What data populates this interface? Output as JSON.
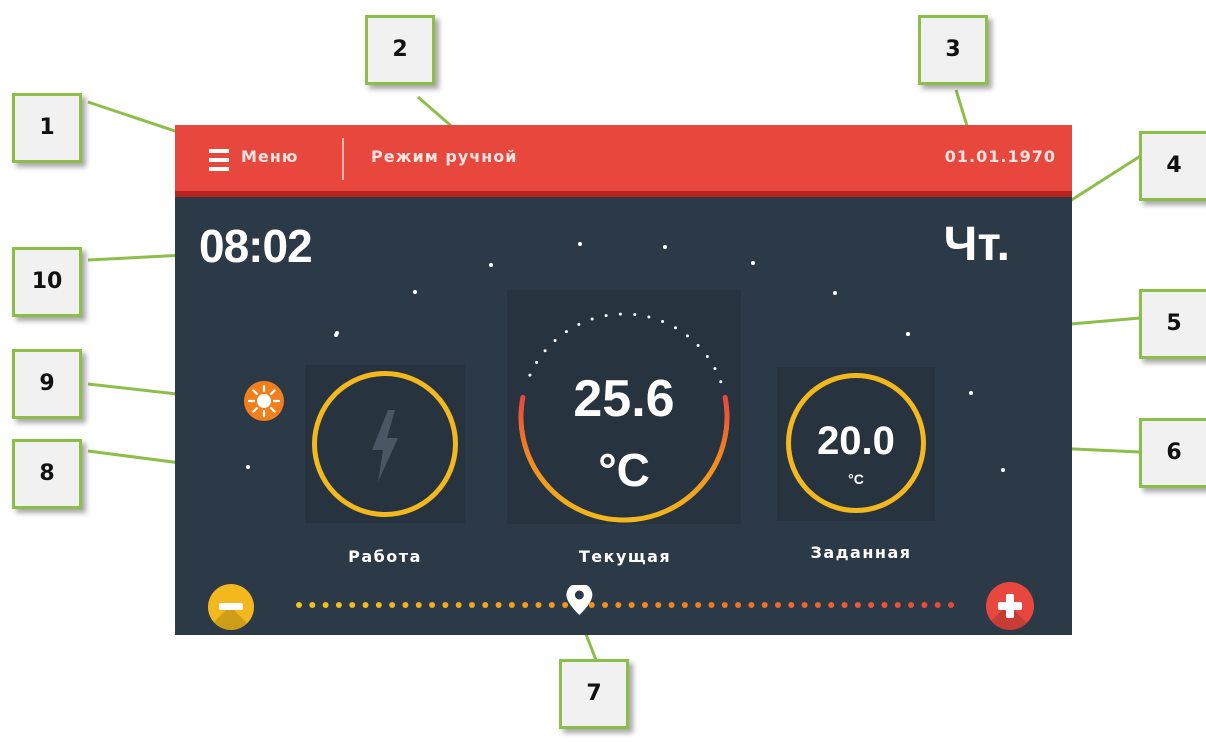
{
  "topbar": {
    "menu_label": "Меню",
    "mode_label": "Режим ручной",
    "date": "01.01.1970"
  },
  "clock": "08:02",
  "weekday": "Чт.",
  "dials": {
    "work": {
      "label": "Работа",
      "icon": "lightning-bolt-icon"
    },
    "current": {
      "label": "Текущая",
      "value": "25.6",
      "unit": "°C"
    },
    "set": {
      "label": "Заданная",
      "value": "20.0",
      "unit": "°C"
    }
  },
  "weather_icon": "sun-icon",
  "slider": {
    "position_fraction": 0.43
  },
  "colors": {
    "topbar": "#e8473e",
    "background": "#2c3a47",
    "ring": "#f2b81d",
    "plus": "#e8473e",
    "minus": "#f2b81d",
    "callout_border": "#8cbf4a"
  },
  "callouts": [
    "1",
    "2",
    "3",
    "4",
    "5",
    "6",
    "7",
    "8",
    "9",
    "10"
  ]
}
